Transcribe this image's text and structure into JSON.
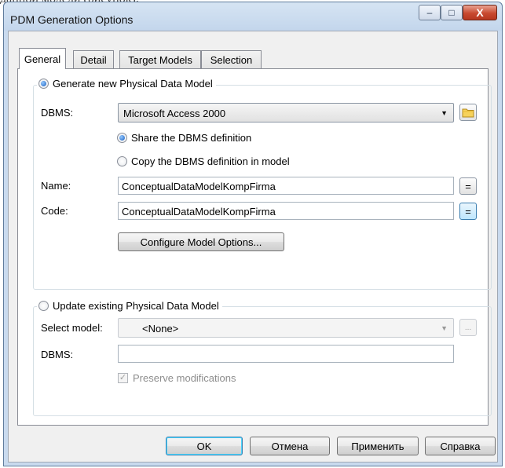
{
  "window": {
    "title": "PDM Generation Options",
    "controls": {
      "minimize": "–",
      "maximize": "□",
      "close": "X"
    }
  },
  "tabs": [
    "General",
    "Detail",
    "Target Models",
    "Selection"
  ],
  "generate_group": {
    "radio_label": "Generate new Physical Data Model",
    "dbms_label": "DBMS:",
    "dbms_value": "Microsoft Access 2000",
    "share_label": "Share the DBMS definition",
    "copy_label": "Copy the DBMS definition in model",
    "name_label": "Name:",
    "name_value": "ConceptualDataModelKompFirma",
    "code_label": "Code:",
    "code_value": "ConceptualDataModelKompFirma",
    "equals_symbol": "=",
    "configure_button": "Configure Model Options..."
  },
  "update_group": {
    "radio_label": "Update existing Physical Data Model",
    "select_model_label": "Select model:",
    "select_model_value": "<None>",
    "browse_label": "...",
    "dbms_label": "DBMS:",
    "dbms_value": "",
    "preserve_label": "Preserve modifications"
  },
  "footer": {
    "ok": "OK",
    "cancel": "Отмена",
    "apply": "Применить",
    "help": "Справка"
  }
}
